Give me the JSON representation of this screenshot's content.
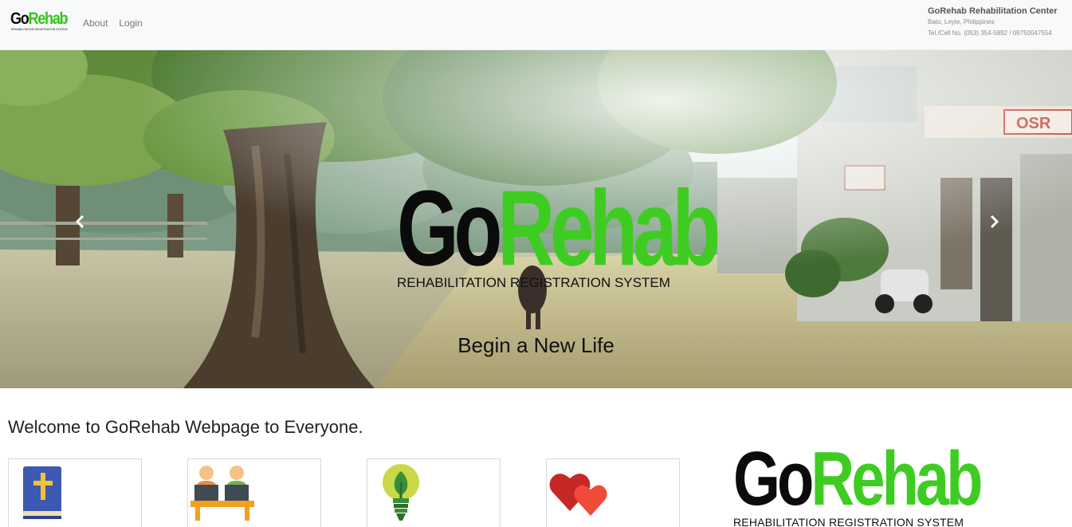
{
  "brand": {
    "go": "Go",
    "rehab": "Rehab",
    "subtitle": "REHABILITATION REGISTRATION SYSTEM"
  },
  "nav": {
    "about": "About",
    "login": "Login"
  },
  "contact": {
    "name": "GoRehab Rehabilitation Center",
    "address": "Bato, Leyte, Philippines",
    "phone": "Tel./Cell No. (053) 354-5892 / 09750047554"
  },
  "carousel": {
    "caption": "Begin a New Life",
    "prev_icon": "chevron-left-icon",
    "next_icon": "chevron-right-icon"
  },
  "welcome": "Welcome to GoRehab Webpage to Everyone.",
  "cards": [
    {
      "icon": "bible-icon"
    },
    {
      "icon": "people-computers-icon"
    },
    {
      "icon": "lightbulb-leaf-icon"
    },
    {
      "icon": "hearts-icon"
    }
  ],
  "colors": {
    "brand_green": "#3fcc22",
    "brand_black": "#0b0b0b",
    "navbar_bg": "#f8f9fa"
  }
}
